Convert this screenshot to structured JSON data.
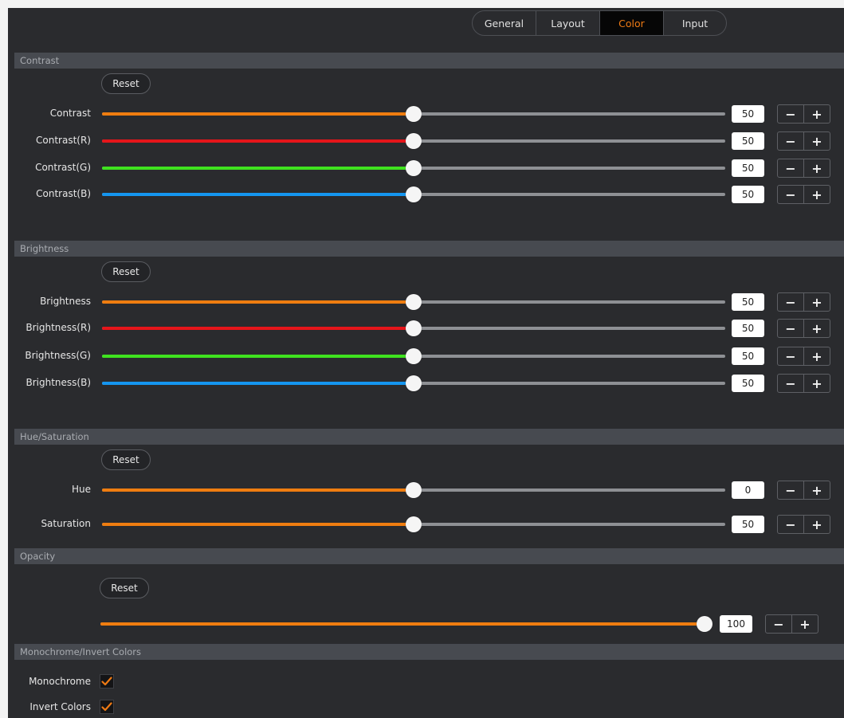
{
  "tabs": [
    {
      "label": "General",
      "active": false
    },
    {
      "label": "Layout",
      "active": false
    },
    {
      "label": "Color",
      "active": true
    },
    {
      "label": "Input",
      "active": false
    }
  ],
  "colors": {
    "orange": "#ef7d10",
    "red": "#e5151a",
    "green": "#3fe21f",
    "blue": "#1596f0",
    "accent": "#ee7a14"
  },
  "sections": {
    "contrast": {
      "title": "Contrast",
      "reset": "Reset",
      "rows": [
        {
          "label": "Contrast",
          "value": "50",
          "level": 0.5,
          "color": "orange"
        },
        {
          "label": "Contrast(R)",
          "value": "50",
          "level": 0.5,
          "color": "red"
        },
        {
          "label": "Contrast(G)",
          "value": "50",
          "level": 0.5,
          "color": "green"
        },
        {
          "label": "Contrast(B)",
          "value": "50",
          "level": 0.5,
          "color": "blue"
        }
      ]
    },
    "brightness": {
      "title": "Brightness",
      "reset": "Reset",
      "rows": [
        {
          "label": "Brightness",
          "value": "50",
          "level": 0.5,
          "color": "orange"
        },
        {
          "label": "Brightness(R)",
          "value": "50",
          "level": 0.5,
          "color": "red"
        },
        {
          "label": "Brightness(G)",
          "value": "50",
          "level": 0.5,
          "color": "green"
        },
        {
          "label": "Brightness(B)",
          "value": "50",
          "level": 0.5,
          "color": "blue"
        }
      ]
    },
    "hue": {
      "title": "Hue/Saturation",
      "reset": "Reset",
      "rows": [
        {
          "label": "Hue",
          "value": "0",
          "level": 0.5,
          "color": "orange"
        },
        {
          "label": "Saturation",
          "value": "50",
          "level": 0.5,
          "color": "orange"
        }
      ]
    },
    "opacity": {
      "title": "Opacity",
      "reset": "Reset",
      "rows": [
        {
          "label": "",
          "value": "100",
          "level": 1.0,
          "color": "orange"
        }
      ]
    },
    "mono": {
      "title": "Monochrome/Invert Colors",
      "checks": [
        {
          "label": "Monochrome",
          "checked": true
        },
        {
          "label": "Invert Colors",
          "checked": true
        }
      ]
    }
  },
  "stepper": {
    "minus": "−",
    "plus": "+"
  },
  "icons": {
    "check": "check-icon",
    "minus": "minus-icon",
    "plus": "plus-icon"
  }
}
